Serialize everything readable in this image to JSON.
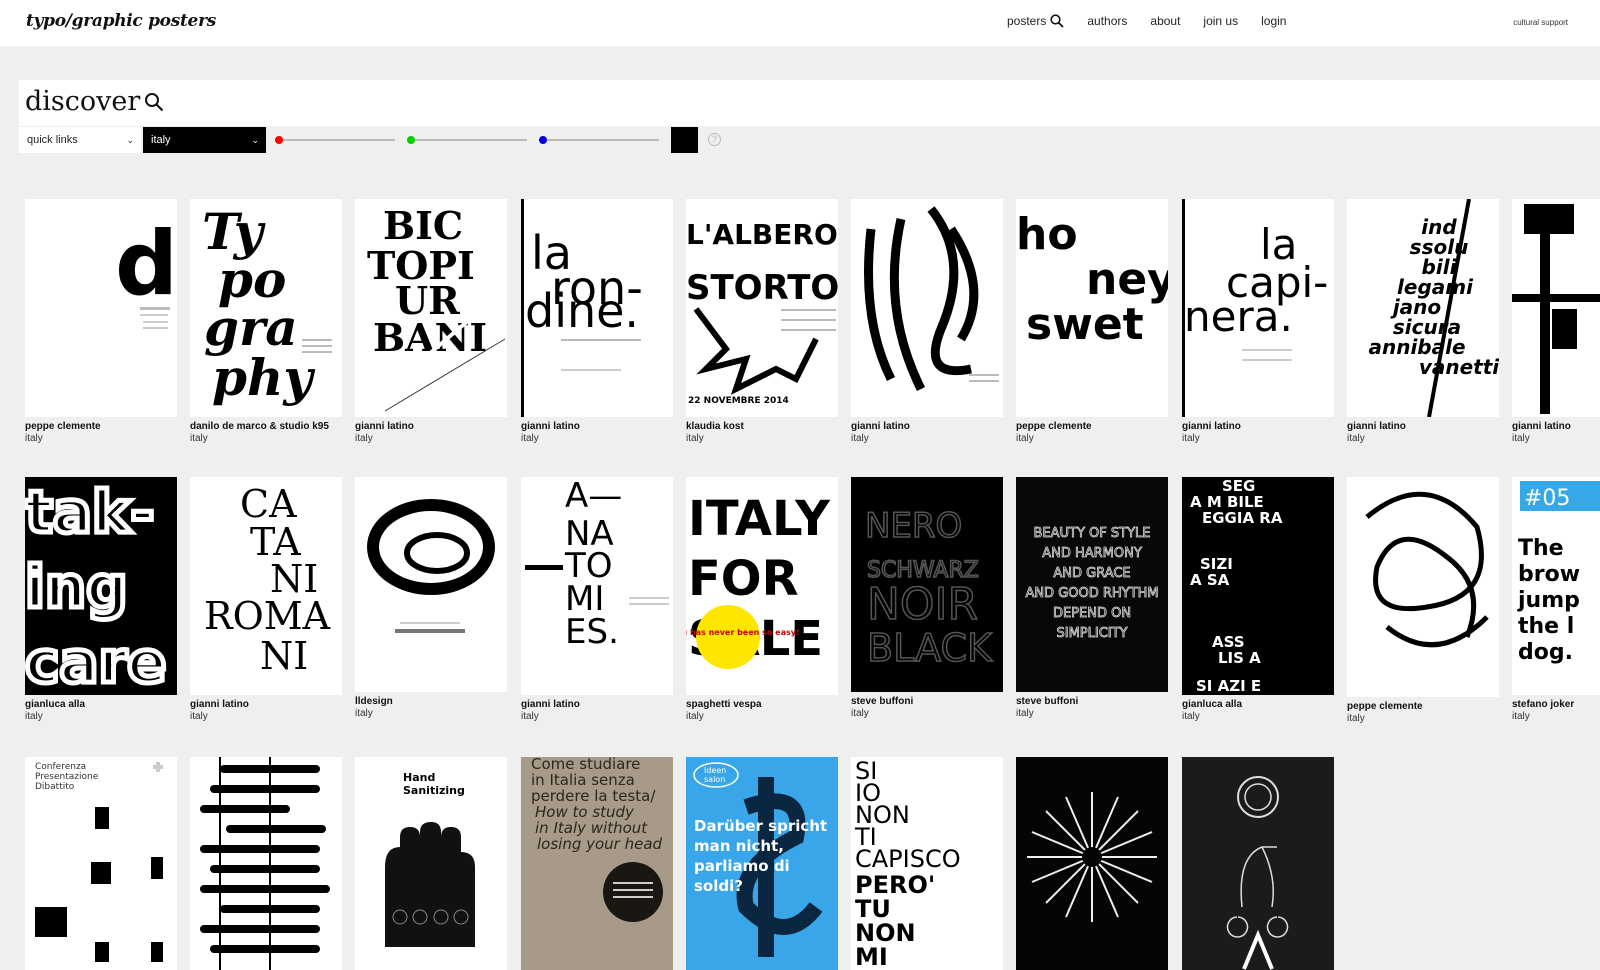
{
  "header": {
    "logo": "typo/graphic posters",
    "nav": [
      "posters",
      "authors",
      "about",
      "join us",
      "login"
    ],
    "cultural_support": "cultural support"
  },
  "search": {
    "label": "discover",
    "quick_links": "quick links",
    "country": "italy",
    "help": "?"
  },
  "colors": {
    "red": "#ff0000",
    "green": "#00d000",
    "blue": "#0000dd",
    "swatch": "#000000"
  },
  "posters": [
    {
      "author": "peppe clemente",
      "country": "italy"
    },
    {
      "author": "danilo de marco & studio k95",
      "country": "italy"
    },
    {
      "author": "gianni latino",
      "country": "italy"
    },
    {
      "author": "gianni latino",
      "country": "italy"
    },
    {
      "author": "klaudia kost",
      "country": "italy"
    },
    {
      "author": "gianni latino",
      "country": "italy"
    },
    {
      "author": "peppe clemente",
      "country": "italy"
    },
    {
      "author": "gianni latino",
      "country": "italy"
    },
    {
      "author": "gianni latino",
      "country": "italy"
    },
    {
      "author": "gianni latino",
      "country": "italy"
    },
    {
      "author": "gianluca alla",
      "country": "italy"
    },
    {
      "author": "gianni latino",
      "country": "italy"
    },
    {
      "author": "lldesign",
      "country": "italy"
    },
    {
      "author": "gianni latino",
      "country": "italy"
    },
    {
      "author": "spaghetti vespa",
      "country": "italy"
    },
    {
      "author": "steve buffoni",
      "country": "italy"
    },
    {
      "author": "steve buffoni",
      "country": "italy"
    },
    {
      "author": "gianluca alla",
      "country": "italy"
    },
    {
      "author": "peppe clemente",
      "country": "italy"
    },
    {
      "author": "stefano joker",
      "country": "italy"
    }
  ],
  "poster_texts": {
    "p1": "d",
    "p2": "Typography",
    "p3": [
      "BIC",
      "TOPI",
      "UR",
      "BANI"
    ],
    "p4": [
      "la",
      "ron-",
      "dine."
    ],
    "p5": [
      "L'ALBERO",
      "STORTO",
      "22 NOVEMBRE 2014"
    ],
    "p7": [
      "ho",
      "ney",
      "swet"
    ],
    "p8": [
      "la",
      "capi-",
      "nera."
    ],
    "p9": [
      "ind",
      "ssolu",
      "bili",
      "legami",
      "jano",
      "sicura",
      "annibale",
      "vanetti"
    ],
    "p11": [
      "tak-",
      "ing",
      "care"
    ],
    "p12": [
      "CA",
      "TA",
      "NI",
      "ROMA",
      "NI"
    ],
    "p14": [
      "A—",
      "NA",
      "TO",
      "MI",
      "ES."
    ],
    "p15": [
      "ITALY",
      "FOR",
      "SALE",
      "buying has never been so easy!"
    ],
    "p16": [
      "NERO",
      "SCHWARZ",
      "NOIR",
      "BLACK"
    ],
    "p17": [
      "BEAUTY OF STYLE",
      "AND HARMONY",
      "AND GRACE",
      "AND GOOD RHYTHM",
      "DEPEND ON",
      "SIMPLICITY"
    ],
    "p18": [
      "SEG",
      "A M BILE",
      "EGGIA RA",
      "SIZI",
      "A SA",
      "ASS",
      "LIS A",
      "SI AZI E"
    ],
    "p20": [
      "#05",
      "The",
      "brow",
      "jump",
      "the l",
      "dog."
    ],
    "p21": [
      "Conferenza",
      "Presentazione",
      "Dibattito"
    ],
    "p23": [
      "Hand",
      "Sanitizing"
    ],
    "p24": [
      "Come studiare",
      "in Italia senza",
      "perdere la testa/",
      "How to study",
      "in Italy without",
      "losing your head"
    ],
    "p25": [
      "Ideen",
      "salon",
      "Darüber spricht",
      "man nicht,",
      "parliamo di",
      "soldi?"
    ],
    "p26": [
      "SI",
      "IO",
      "NON",
      "TI",
      "CAPISCO",
      "PERO'",
      "TU",
      "NON",
      "MI"
    ]
  }
}
